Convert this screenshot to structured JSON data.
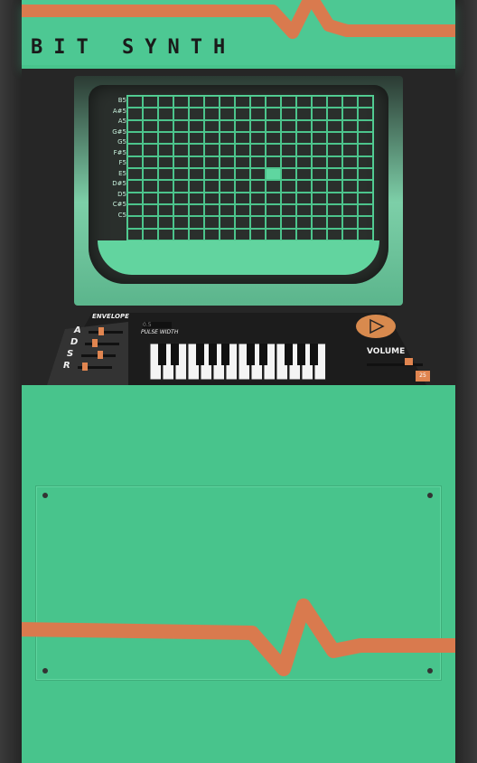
{
  "app": {
    "title": "BIT SYNTH"
  },
  "menu": {
    "icon": "hamburger-menu-icon"
  },
  "sequencer": {
    "notes": [
      "B5",
      "A#5",
      "A5",
      "G#5",
      "G5",
      "F#5",
      "F5",
      "E5",
      "D#5",
      "D5",
      "C#5",
      "C5"
    ],
    "steps": 16,
    "active_cells": [
      {
        "note": "F5",
        "step": 9
      }
    ]
  },
  "envelope": {
    "label": "ENVELOPE",
    "params": [
      {
        "name": "A",
        "level": 0.35
      },
      {
        "name": "D",
        "level": 0.25
      },
      {
        "name": "S",
        "level": 0.55
      },
      {
        "name": "R",
        "level": 0.15
      }
    ]
  },
  "pulse_width": {
    "label": "PULSE WIDTH",
    "value": "0.5"
  },
  "volume": {
    "label": "VOLUME",
    "level": 0.75,
    "coin_label": "25"
  },
  "colors": {
    "accent": "#e08550",
    "teal": "#48c48c",
    "dark": "#262626"
  }
}
